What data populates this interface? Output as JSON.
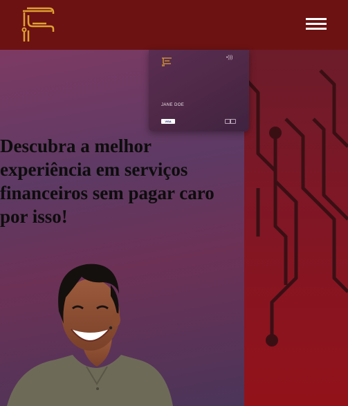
{
  "header": {
    "logo_icon": "brand-logo-f",
    "menu_icon": "hamburger-menu-icon",
    "background": "#6c1212",
    "accent": "#e0a032"
  },
  "card": {
    "holder_name": "JANE DOE",
    "contactless_icon": "contactless-icon",
    "brand": "VISA",
    "chip_icon": "chip-icon"
  },
  "hero": {
    "heading": "Descubra a melhor experiência em serviços financeiros sem pagar caro por isso!"
  },
  "colors": {
    "left_panel": "#5d3a64",
    "right_panel": "#93121a",
    "circuit": "#3a0f14"
  }
}
